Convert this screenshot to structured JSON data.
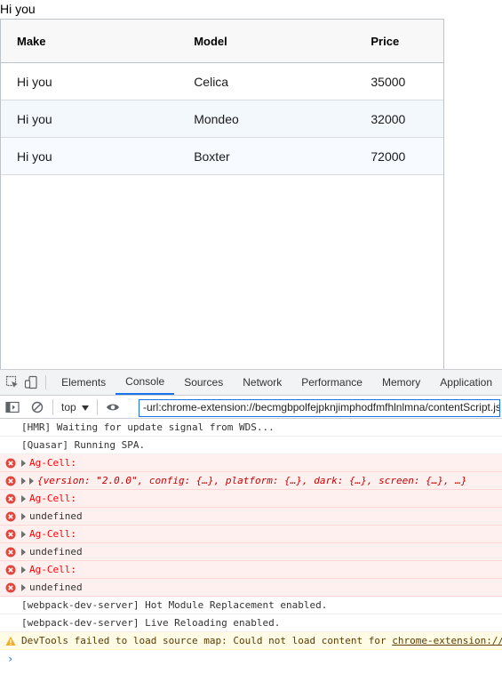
{
  "page": {
    "text": "Hi you"
  },
  "grid": {
    "columns": [
      "Make",
      "Model",
      "Price"
    ],
    "rows": [
      {
        "make": "Hi you",
        "model": "Celica",
        "price": "35000"
      },
      {
        "make": "Hi you",
        "model": "Mondeo",
        "price": "32000"
      },
      {
        "make": "Hi you",
        "model": "Boxter",
        "price": "72000"
      }
    ]
  },
  "devtools": {
    "tabs": [
      "Elements",
      "Console",
      "Sources",
      "Network",
      "Performance",
      "Memory",
      "Application"
    ],
    "active_tab": "Console",
    "context": "top",
    "filter_value": "-url:chrome-extension://becmgbpolfejpknjimphodfmfhlnlmna/contentScript.js",
    "accent_color": "#1a73e8"
  },
  "console": {
    "messages": [
      {
        "level": "info",
        "text": "[HMR] Waiting for update signal from WDS..."
      },
      {
        "level": "info",
        "text": "[Quasar] Running SPA."
      },
      {
        "level": "error",
        "text": "Ag-Cell:"
      },
      {
        "level": "error",
        "text": "{version: \"2.0.0\", config: {…}, platform: {…}, dark: {…}, screen: {…}, …}"
      },
      {
        "level": "error",
        "text": "Ag-Cell:"
      },
      {
        "level": "error",
        "text": "undefined"
      },
      {
        "level": "error",
        "text": "Ag-Cell:"
      },
      {
        "level": "error",
        "text": "undefined"
      },
      {
        "level": "error",
        "text": "Ag-Cell:"
      },
      {
        "level": "error",
        "text": "undefined"
      },
      {
        "level": "info",
        "text": "[webpack-dev-server] Hot Module Replacement enabled."
      },
      {
        "level": "info",
        "text": "[webpack-dev-server] Live Reloading enabled."
      },
      {
        "level": "warning",
        "text": "DevTools failed to load source map: Could not load content for",
        "link": "chrome-extension://"
      }
    ],
    "prompt_symbol": "›"
  }
}
